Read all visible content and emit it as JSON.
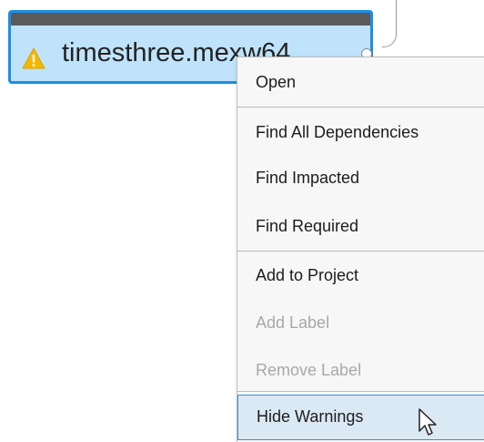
{
  "node": {
    "label": "timesthree.mexw64",
    "status_icon": "warning-icon",
    "accent_color": "#1b8ee6",
    "fill_color": "#bfe3fb",
    "header_color": "#5a5a5a"
  },
  "context_menu": {
    "items": [
      {
        "label": "Open",
        "enabled": true
      },
      {
        "label": "Find All Dependencies",
        "enabled": true
      },
      {
        "label": "Find Impacted",
        "enabled": true
      },
      {
        "label": "Find Required",
        "enabled": true
      },
      {
        "label": "Add to Project",
        "enabled": true
      },
      {
        "label": "Add Label",
        "enabled": false
      },
      {
        "label": "Remove Label",
        "enabled": false
      },
      {
        "label": "Hide Warnings",
        "enabled": true,
        "hovered": true
      }
    ]
  },
  "cursor": {
    "icon": "arrow-cursor-icon"
  }
}
